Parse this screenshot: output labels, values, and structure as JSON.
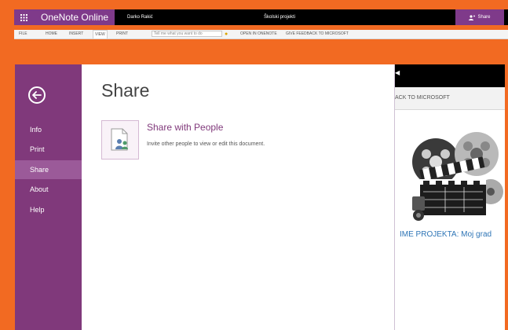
{
  "top_app": {
    "app_title": "OneNote Online",
    "user_name": "Darko Rakić",
    "document_title": "Školski projekti",
    "share_button": "Share"
  },
  "top_ribbon": {
    "tabs": [
      "FILE",
      "HOME",
      "INSERT",
      "VIEW",
      "PRINT"
    ],
    "tell_me_placeholder": "Tell me what you want to do",
    "actions": [
      "OPEN IN ONENOTE",
      "GIVE FEEDBACK TO MICROSOFT"
    ]
  },
  "backstage": {
    "nav_items": [
      "Info",
      "Print",
      "Share",
      "About",
      "Help"
    ],
    "selected": "Share",
    "heading": "Share",
    "option": {
      "title": "Share with People",
      "description": "Invite other people to view or edit this document."
    }
  },
  "document": {
    "ribbon_text": "ACK TO MICROSOFT",
    "project_title": "IME PROJEKTA: Moj grad"
  },
  "colors": {
    "accent_purple": "#80397b",
    "background_orange": "#f26a22",
    "link_blue": "#2e75b6"
  }
}
